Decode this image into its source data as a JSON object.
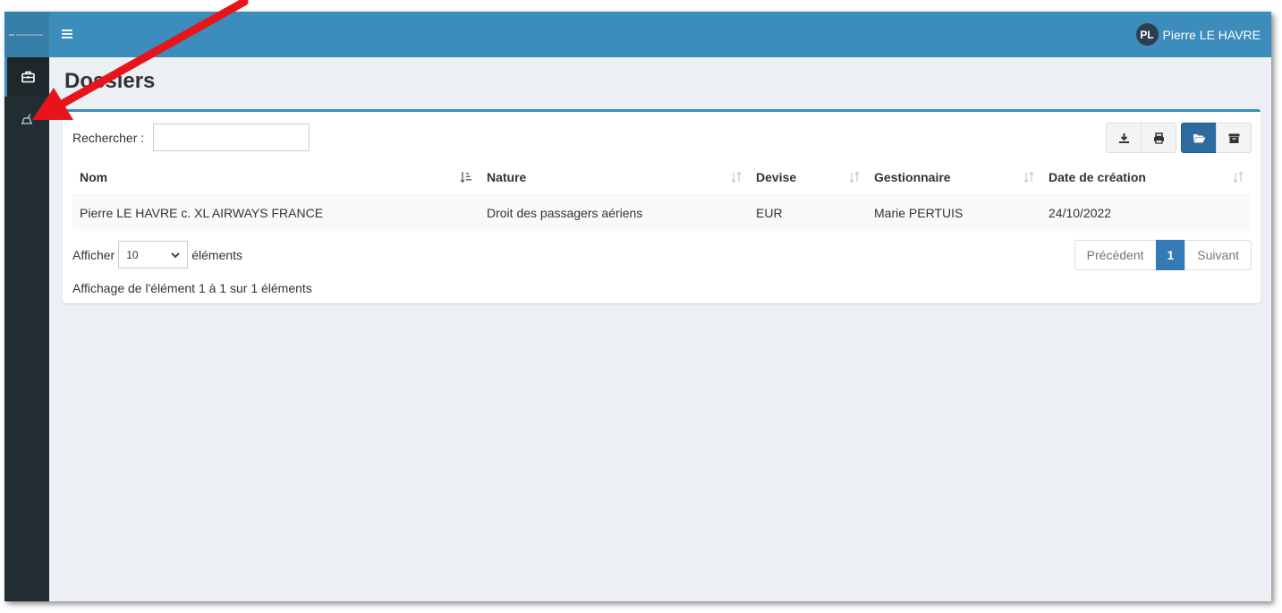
{
  "user": {
    "initials": "PL",
    "name": "Pierre LE HAVRE"
  },
  "sidebar": {
    "items": [
      {
        "icon": "briefcase-icon",
        "active": true
      },
      {
        "icon": "scale-icon",
        "active": false
      }
    ]
  },
  "page": {
    "title": "Dossiers"
  },
  "search": {
    "label": "Rechercher :",
    "value": ""
  },
  "toolbar": {
    "buttons": [
      {
        "icon": "download-icon"
      },
      {
        "icon": "print-icon"
      },
      {
        "icon": "folder-open-icon",
        "selected": true
      },
      {
        "icon": "archive-icon"
      }
    ]
  },
  "table": {
    "columns": [
      {
        "label": "Nom",
        "sorted": "asc"
      },
      {
        "label": "Nature"
      },
      {
        "label": "Devise"
      },
      {
        "label": "Gestionnaire"
      },
      {
        "label": "Date de création"
      }
    ],
    "rows": [
      [
        "Pierre LE HAVRE c. XL AIRWAYS FRANCE",
        "Droit des passagers aériens",
        "EUR",
        "Marie PERTUIS",
        "24/10/2022"
      ]
    ]
  },
  "length": {
    "prefix": "Afficher",
    "value": "10",
    "suffix": "éléments"
  },
  "pagination": {
    "previous": "Précédent",
    "current": "1",
    "next": "Suivant"
  },
  "info": "Affichage de l'élément 1 à 1 sur 1 éléments",
  "colors": {
    "topbar": "#3c8dbc",
    "sidebar": "#222d32",
    "annotation_arrow": "#e8141b"
  }
}
